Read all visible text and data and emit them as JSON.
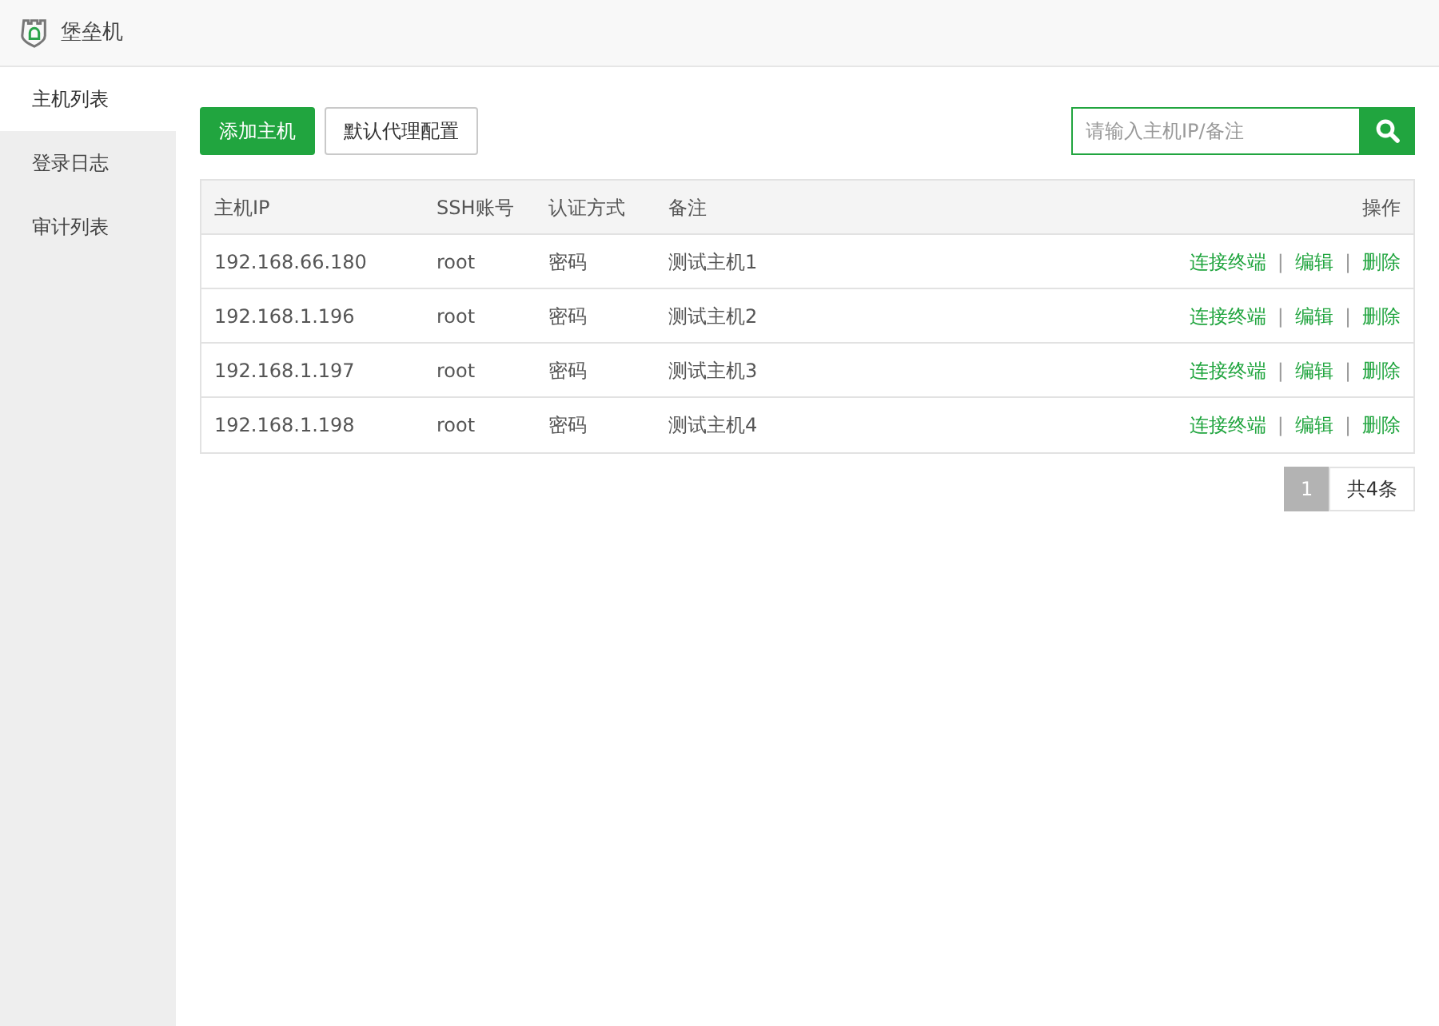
{
  "header": {
    "title": "堡垒机"
  },
  "sidebar": {
    "items": [
      {
        "label": "主机列表",
        "selected": true
      },
      {
        "label": "登录日志",
        "selected": false
      },
      {
        "label": "审计列表",
        "selected": false
      }
    ]
  },
  "toolbar": {
    "buttons": [
      {
        "label": "添加主机",
        "kind": "primary"
      },
      {
        "label": "默认代理配置",
        "kind": "default"
      }
    ],
    "search": {
      "placeholder": "请输入主机IP/备注"
    }
  },
  "table": {
    "columns": [
      "主机IP",
      "SSH账号",
      "认证方式",
      "备注",
      "操作"
    ],
    "rows": [
      {
        "cells": [
          "192.168.66.180",
          "root",
          "密码",
          "测试主机1"
        ],
        "actions": [
          {
            "kind": "link",
            "text": "连接终端"
          },
          {
            "kind": "separator",
            "text": "|"
          },
          {
            "kind": "link",
            "text": "编辑"
          },
          {
            "kind": "separator",
            "text": "|"
          },
          {
            "kind": "link",
            "text": "删除"
          }
        ]
      },
      {
        "cells": [
          "192.168.1.196",
          "root",
          "密码",
          "测试主机2"
        ],
        "actions": [
          {
            "kind": "link",
            "text": "连接终端"
          },
          {
            "kind": "separator",
            "text": "|"
          },
          {
            "kind": "link",
            "text": "编辑"
          },
          {
            "kind": "separator",
            "text": "|"
          },
          {
            "kind": "link",
            "text": "删除"
          }
        ]
      },
      {
        "cells": [
          "192.168.1.197",
          "root",
          "密码",
          "测试主机3"
        ],
        "actions": [
          {
            "kind": "link",
            "text": "连接终端"
          },
          {
            "kind": "separator",
            "text": "|"
          },
          {
            "kind": "link",
            "text": "编辑"
          },
          {
            "kind": "separator",
            "text": "|"
          },
          {
            "kind": "link",
            "text": "删除"
          }
        ]
      },
      {
        "cells": [
          "192.168.1.198",
          "root",
          "密码",
          "测试主机4"
        ],
        "actions": [
          {
            "kind": "link",
            "text": "连接终端"
          },
          {
            "kind": "separator",
            "text": "|"
          },
          {
            "kind": "link",
            "text": "编辑"
          },
          {
            "kind": "separator",
            "text": "|"
          },
          {
            "kind": "link",
            "text": "删除"
          }
        ]
      }
    ]
  },
  "pagination": {
    "pages": [
      {
        "label": "1",
        "selected": true
      }
    ],
    "total": "共4条"
  }
}
